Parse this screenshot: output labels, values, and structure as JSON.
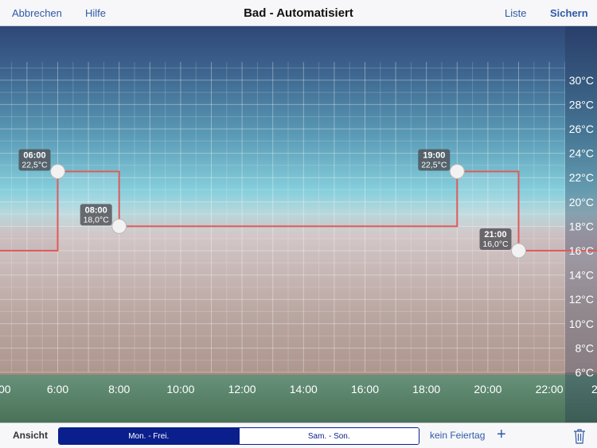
{
  "navbar": {
    "cancel_label": "Abbrechen",
    "help_label": "Hilfe",
    "title": "Bad - Automatisiert",
    "list_label": "Liste",
    "save_label": "Sichern"
  },
  "chart_data": {
    "type": "line",
    "step": true,
    "x_unit": "time of day",
    "y_unit": "°C",
    "x_ticks": [
      "00",
      "6:00",
      "8:00",
      "10:00",
      "12:00",
      "14:00",
      "16:00",
      "18:00",
      "20:00",
      "22:00",
      "2"
    ],
    "y_ticks": [
      "30°C",
      "28°C",
      "26°C",
      "24°C",
      "22°C",
      "20°C",
      "18°C",
      "16°C",
      "14°C",
      "12°C",
      "10°C",
      "8°C",
      "6°C"
    ],
    "x_range_hours": [
      4,
      24.3
    ],
    "y_range_celsius": [
      6,
      30
    ],
    "grid": true,
    "line_color": "#e05a5a",
    "series": [
      {
        "points": [
          {
            "time": "06:00",
            "hours": 6,
            "value": 22.5,
            "time_label": "06:00",
            "value_label": "22,5°C"
          },
          {
            "time": "08:00",
            "hours": 8,
            "value": 18.0,
            "time_label": "08:00",
            "value_label": "18,0°C"
          },
          {
            "time": "19:00",
            "hours": 19,
            "value": 22.5,
            "time_label": "19:00",
            "value_label": "22,5°C"
          },
          {
            "time": "21:00",
            "hours": 21,
            "value": 16.0,
            "time_label": "21:00",
            "value_label": "16,0°C"
          }
        ]
      }
    ]
  },
  "footer": {
    "view_label": "Ansicht",
    "segments": [
      {
        "label": "Mon. - Frei.",
        "selected": true
      },
      {
        "label": "Sam. - Son.",
        "selected": false
      }
    ],
    "holiday_label": "kein Feiertag",
    "add_icon": "+",
    "trash_icon": "trash-icon"
  }
}
